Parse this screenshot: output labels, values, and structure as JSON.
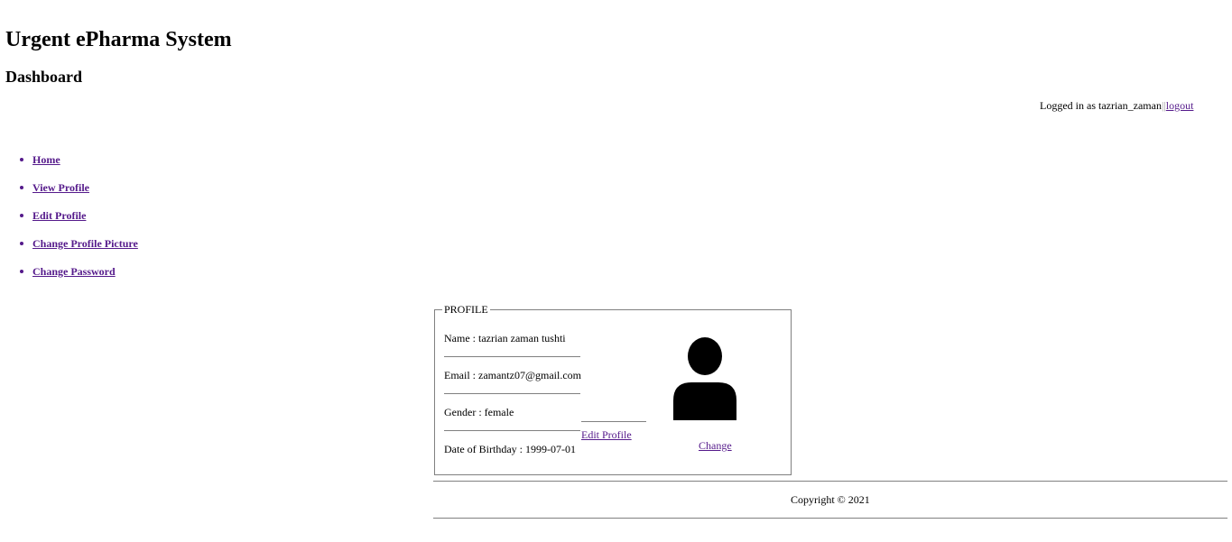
{
  "header": {
    "title": "Urgent ePharma System",
    "page_heading": "Dashboard"
  },
  "login": {
    "prefix": "Logged in as tazrian_zaman",
    "separator": "||",
    "logout_label": "logout"
  },
  "nav": {
    "items": [
      {
        "label": "Home"
      },
      {
        "label": "View Profile"
      },
      {
        "label": "Edit Profile"
      },
      {
        "label": "Change Profile Picture"
      },
      {
        "label": "Change Password"
      }
    ]
  },
  "profile": {
    "legend": "PROFILE",
    "name": "Name : tazrian zaman tushti",
    "email": "Email : zamantz07@gmail.com",
    "gender": "Gender : female",
    "dob": "Date of Birthday : 1999-07-01",
    "edit_label": "Edit Profile",
    "change_label": "Change",
    "avatar_icon": "user-avatar-icon"
  },
  "footer": {
    "copyright": "Copyright © 2021"
  }
}
